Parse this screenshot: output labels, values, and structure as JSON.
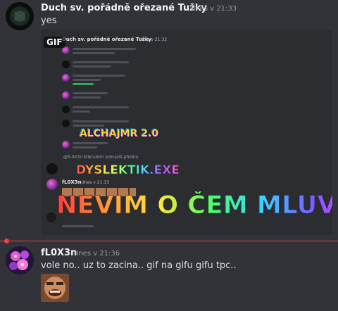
{
  "messages": [
    {
      "author": "Duch sv. pořádně ořezané Tužky",
      "timestamp": "dnes v 21:33",
      "content": "yes",
      "author_color": "#f2f3f5"
    },
    {
      "author": "fL0X3n",
      "timestamp": "dnes v 21:36",
      "content": "vole no.. uz to zacina.. gif na gifu gifu tpc..",
      "author_color": "#f2f3f5"
    }
  ],
  "gif": {
    "badge": "GIF",
    "inner_author": "Duch sv. pořádně ořezané Tužky",
    "inner_timestamp": "dnes v 21:32",
    "reply_note": "@fL0X3n Kliknutím zobrazíš přílohu",
    "inner_author_2": "fL0X3n",
    "inner_timestamp_2": "dnes v 21:33",
    "overlay_1": "ALCHAJMR 2.0",
    "overlay_2": "DYSLEKTIK.EXE",
    "overlay_3": "NEVIM O ČEM MLUVÍŠ"
  },
  "colors": {
    "background": "#313338",
    "divider": "#f23f43",
    "muted_text": "#949ba4"
  },
  "icons": {
    "avatar_1": "dark-avatar",
    "avatar_2": "flower-avatar",
    "attachment_thumb": "laughing-face-image"
  }
}
